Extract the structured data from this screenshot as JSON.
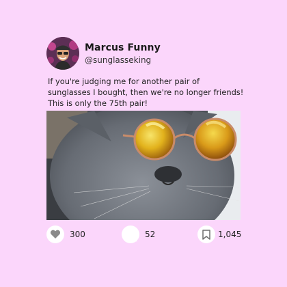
{
  "post": {
    "author_name": "Marcus Funny",
    "author_handle": "@sunglasseking",
    "text": "If you're judging me for another pair of sunglasses I bought, then we're no longer friends! This is only the 75th pair!"
  },
  "actions": {
    "likes": "300",
    "comments": "52",
    "bookmarks": "1,045"
  },
  "icons": {
    "like": "heart-icon",
    "comment": "speech-bubble-icon",
    "bookmark": "bookmark-icon"
  },
  "colors": {
    "background": "#fbd6fb",
    "card_button": "#ffffff",
    "icon": "#8a8a8a"
  }
}
